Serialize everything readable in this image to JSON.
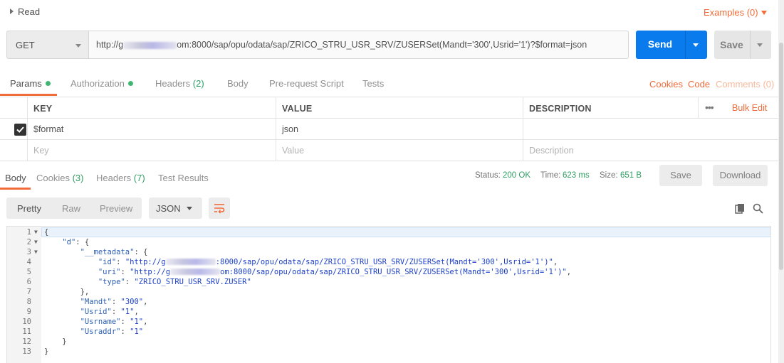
{
  "section": {
    "title": "Read",
    "examples_label": "Examples (0)"
  },
  "request": {
    "method": "GET",
    "url_prefix": "http://g",
    "url_suffix": "om:8000/sap/opu/odata/sap/ZRICO_STRU_USR_SRV/ZUSERSet(Mandt='300',Usrid='1')?$format=json",
    "send_label": "Send",
    "save_label": "Save"
  },
  "request_tabs": {
    "params": "Params",
    "authorization": "Authorization",
    "headers": "Headers",
    "headers_count": "(2)",
    "body": "Body",
    "prerequest": "Pre-request Script",
    "tests": "Tests",
    "cookies": "Cookies",
    "code": "Code",
    "comments": "Comments (0)"
  },
  "params_table": {
    "headers": {
      "key": "KEY",
      "value": "VALUE",
      "description": "DESCRIPTION",
      "bulk_edit": "Bulk Edit"
    },
    "rows": [
      {
        "key": "$format",
        "value": "json",
        "description": "",
        "checked": true
      }
    ],
    "placeholders": {
      "key": "Key",
      "value": "Value",
      "description": "Description"
    }
  },
  "response_tabs": {
    "body": "Body",
    "cookies": "Cookies",
    "cookies_count": "(3)",
    "headers": "Headers",
    "headers_count": "(7)",
    "test_results": "Test Results"
  },
  "response_meta": {
    "status_label": "Status:",
    "status_value": "200 OK",
    "time_label": "Time:",
    "time_value": "623 ms",
    "size_label": "Size:",
    "size_value": "651 B",
    "save_label": "Save",
    "download_label": "Download"
  },
  "view": {
    "pretty": "Pretty",
    "raw": "Raw",
    "preview": "Preview",
    "format": "JSON"
  },
  "code": {
    "line_numbers": [
      "1",
      "2",
      "3",
      "4",
      "5",
      "6",
      "7",
      "8",
      "9",
      "10",
      "11",
      "12",
      "13"
    ],
    "l1": "{",
    "l2_key": "\"d\"",
    "l2_rest": ": {",
    "l3_key": "\"__metadata\"",
    "l3_rest": ": {",
    "l4_key": "\"id\"",
    "l4_pre": "\"http://g",
    "l4_post": ":8000/sap/opu/odata/sap/ZRICO_STRU_USR_SRV/ZUSERSet(Mandt='300',Usrid='1')\"",
    "l5_key": "\"uri\"",
    "l5_pre": "\"http://g",
    "l5_post": "om:8000/sap/opu/odata/sap/ZRICO_STRU_USR_SRV/ZUSERSet(Mandt='300',Usrid='1')\"",
    "l6_key": "\"type\"",
    "l6_val": "\"ZRICO_STRU_USR_SRV.ZUSER\"",
    "l7": "},",
    "l8_key": "\"Mandt\"",
    "l8_val": "\"300\"",
    "l9_key": "\"Usrid\"",
    "l9_val": "\"1\"",
    "l10_key": "\"Usrname\"",
    "l10_val": "\"1\"",
    "l11_key": "\"Usraddr\"",
    "l11_val": "\"1\"",
    "l12": "}",
    "l13": "}"
  },
  "colors": {
    "accent": "#f26b3a",
    "send": "#097bed",
    "success": "#2e9e62"
  }
}
